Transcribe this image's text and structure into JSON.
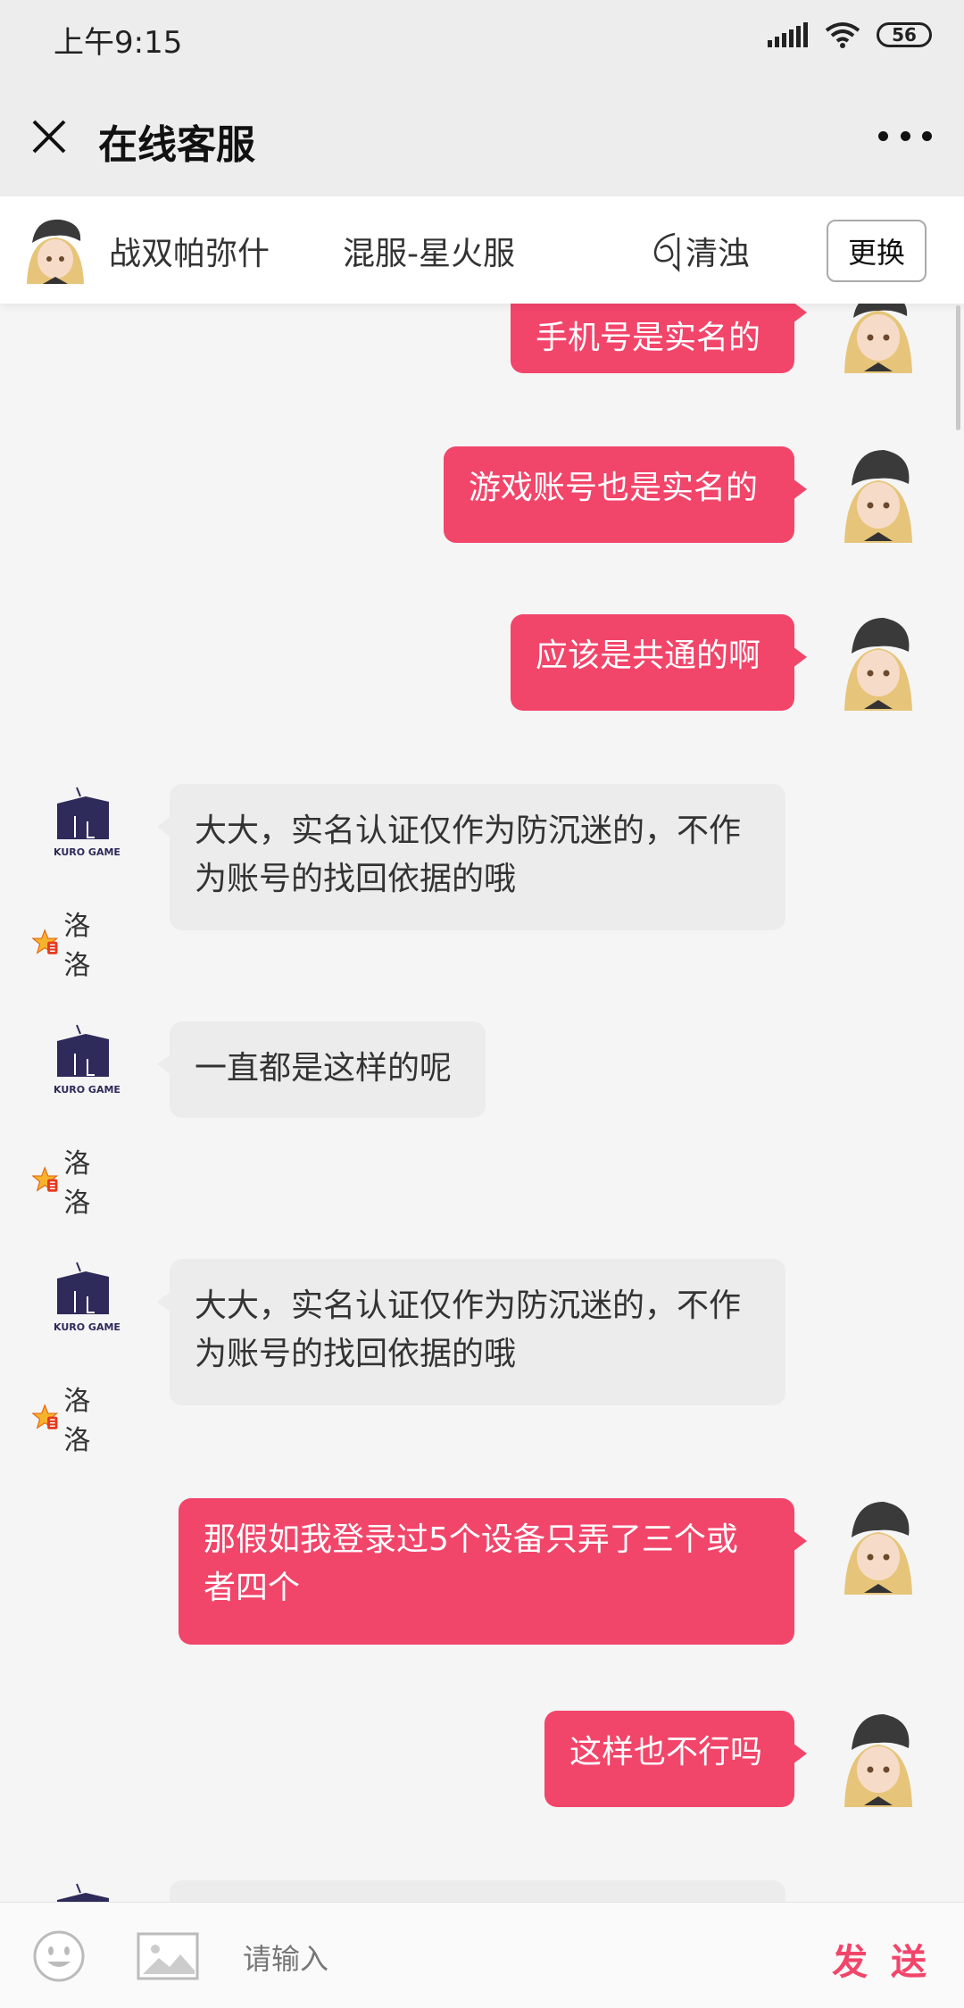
{
  "status_bar": {
    "time": "上午9:15",
    "battery": "56"
  },
  "header": {
    "title": "在线客服"
  },
  "info_bar": {
    "game": "战双帕弥什",
    "server": "混服-星火服",
    "player": "清浊",
    "change_label": "更换"
  },
  "messages": [
    {
      "from": "user",
      "text": "手机号是实名的"
    },
    {
      "from": "user",
      "text": "游戏账号也是实名的"
    },
    {
      "from": "user",
      "text": "应该是共通的啊"
    },
    {
      "from": "agent",
      "name": "洛洛",
      "text": "大大，实名认证仅作为防沉迷的，不作为账号的找回依据的哦"
    },
    {
      "from": "agent",
      "name": "洛洛",
      "text": "一直都是这样的呢"
    },
    {
      "from": "agent",
      "name": "洛洛",
      "text": "大大，实名认证仅作为防沉迷的，不作为账号的找回依据的哦"
    },
    {
      "from": "user",
      "text": "那假如我登录过5个设备只弄了三个或者四个"
    },
    {
      "from": "user",
      "text": "这样也不行吗"
    }
  ],
  "input": {
    "placeholder": "请输入",
    "send_label": "发 送"
  },
  "colors": {
    "accent": "#f2456a",
    "agent_bubble": "#ececec"
  }
}
